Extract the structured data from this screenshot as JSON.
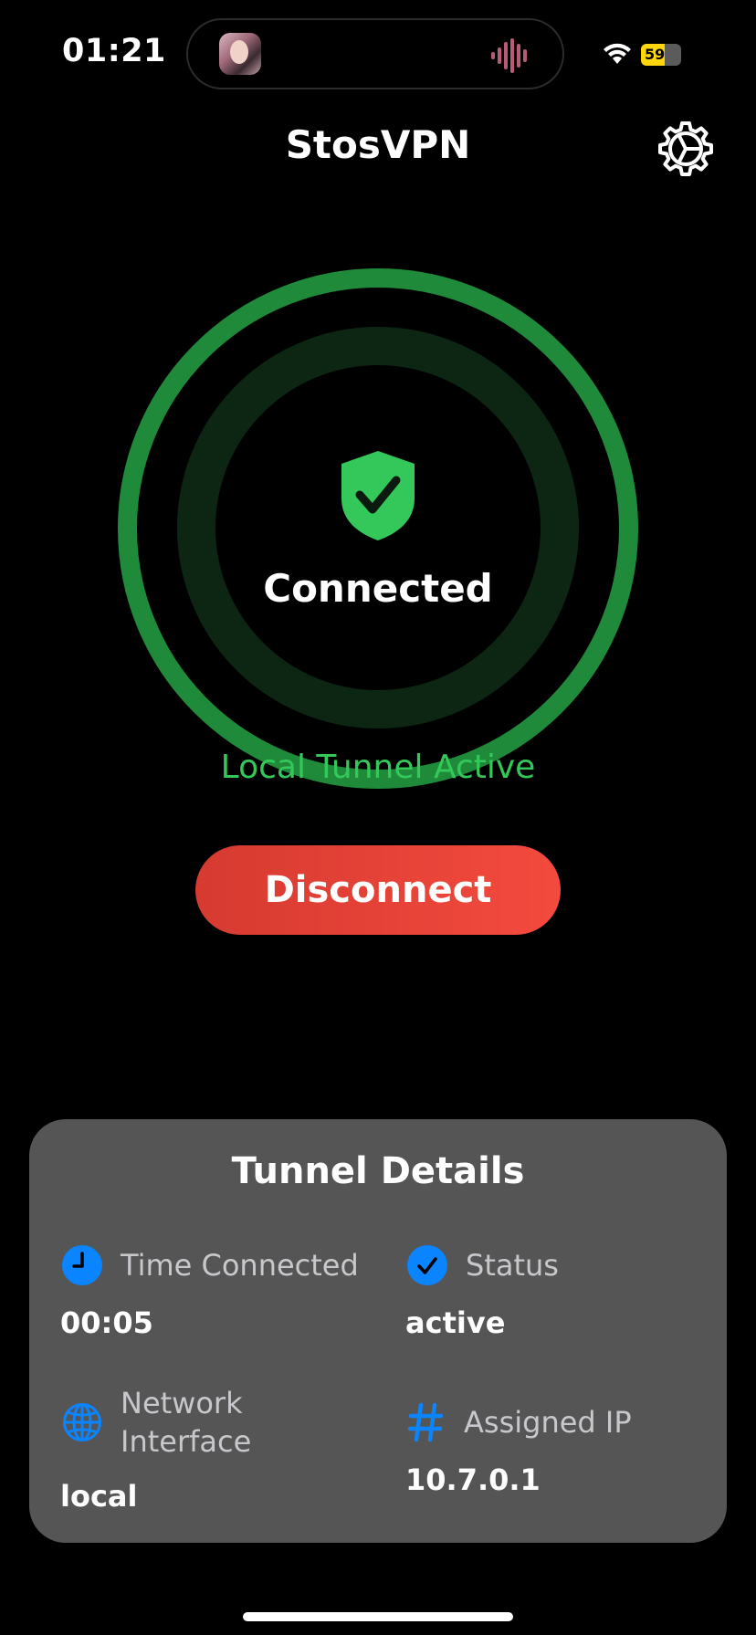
{
  "status_bar": {
    "time": "01:21",
    "battery_level": "59",
    "battery_fill_percent": 59
  },
  "header": {
    "title": "StosVPN"
  },
  "connection": {
    "state_label": "Connected",
    "subtitle": "Local Tunnel Active",
    "action_label": "Disconnect"
  },
  "details": {
    "title": "Tunnel Details",
    "time_connected": {
      "label": "Time Connected",
      "value": "00:05"
    },
    "status": {
      "label": "Status",
      "value": "active"
    },
    "network_interface": {
      "label_line1": "Network",
      "label_line2": "Interface",
      "value": "local"
    },
    "assigned_ip": {
      "label": "Assigned IP",
      "value": "10.7.0.1"
    }
  },
  "colors": {
    "accent_green": "#34c759",
    "ring_green": "#1f8a3a",
    "disconnect_red": "#f44a3e",
    "icon_blue": "#0a84ff",
    "card_gray": "#555555"
  },
  "icons": [
    "wifi-icon",
    "gear-icon",
    "shield-check-icon",
    "clock-icon",
    "checkmark-icon",
    "globe-icon",
    "hash-icon"
  ]
}
